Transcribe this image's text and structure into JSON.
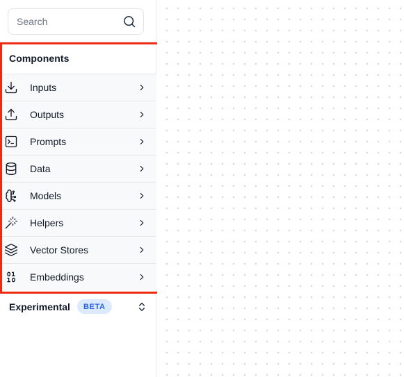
{
  "search": {
    "placeholder": "Search",
    "icon": "search-icon"
  },
  "components": {
    "title": "Components",
    "highlight_color": "#ee2b10",
    "items": [
      {
        "label": "Inputs",
        "icon": "download-icon"
      },
      {
        "label": "Outputs",
        "icon": "upload-icon"
      },
      {
        "label": "Prompts",
        "icon": "terminal-square-icon"
      },
      {
        "label": "Data",
        "icon": "database-icon"
      },
      {
        "label": "Models",
        "icon": "brain-circuit-icon"
      },
      {
        "label": "Helpers",
        "icon": "wand-sparkles-icon"
      },
      {
        "label": "Vector Stores",
        "icon": "layers-icon"
      },
      {
        "label": "Embeddings",
        "icon": "binary-icon"
      }
    ]
  },
  "experimental": {
    "title": "Experimental",
    "badge": "BETA",
    "badge_bg": "#dbeafe",
    "badge_color": "#2563eb"
  }
}
